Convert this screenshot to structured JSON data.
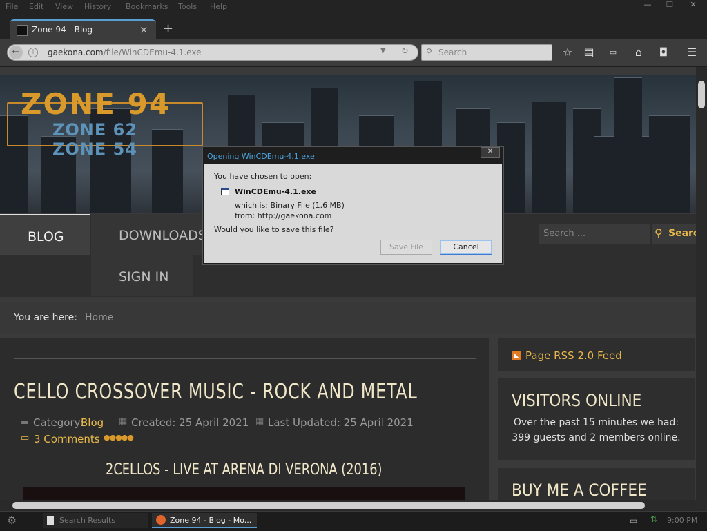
{
  "menubar": {
    "items": [
      "File",
      "Edit",
      "View",
      "History",
      "Bookmarks",
      "Tools",
      "Help"
    ],
    "controls": [
      "—",
      "❐",
      "✕"
    ]
  },
  "tab": {
    "title": "Zone 94 - Blog",
    "close": "×",
    "new_tab": "+"
  },
  "nav": {
    "url_host": "gaekona.com",
    "url_path": "/file/WinCDEmu-4.1.exe",
    "search_placeholder": "Search"
  },
  "site": {
    "logo_main": "ZONE 94",
    "logo_sub1": "ZONE 62",
    "logo_sub2": "ZONE 54",
    "menu": [
      "BLOG",
      "DOWNLOADS",
      "SIGN IN"
    ],
    "search_placeholder": "Search ...",
    "search_button": "Search",
    "breadcrumb_label": "You are here:",
    "breadcrumb_home": "Home"
  },
  "article": {
    "title": "CELLO CROSSOVER MUSIC - ROCK AND METAL",
    "category_label": "Category:",
    "category": "Blog",
    "created": "Created: 25 April 2021",
    "updated": "Last Updated: 25 April 2021",
    "comments": "3 Comments",
    "subtitle": "2CELLOS - LIVE AT ARENA DI VERONA (2016)"
  },
  "sidebar": {
    "rss": "Page RSS 2.0 Feed",
    "visitors_title": "VISITORS ONLINE",
    "visitors_text1": "Over the past 15 minutes we had:",
    "visitors_text2": "399 guests and 2 members online.",
    "coffee_title": "BUY ME A COFFEE"
  },
  "dialog": {
    "title": "Opening WinCDEmu-4.1.exe",
    "chosen": "You have chosen to open:",
    "filename": "WinCDEmu-4.1.exe",
    "which_is": "which is: Binary File (1.6 MB)",
    "from": "from: http://gaekona.com",
    "question": "Would you like to save this file?",
    "save": "Save File",
    "cancel": "Cancel"
  },
  "taskbar": {
    "item1": "Search Results",
    "item2": "Zone 94 - Blog - Mo...",
    "clock": "9:00 PM"
  },
  "colors": {
    "accent": "#d99a2b",
    "link": "#e8b84a",
    "dialog_title": "#4aa3e0"
  }
}
